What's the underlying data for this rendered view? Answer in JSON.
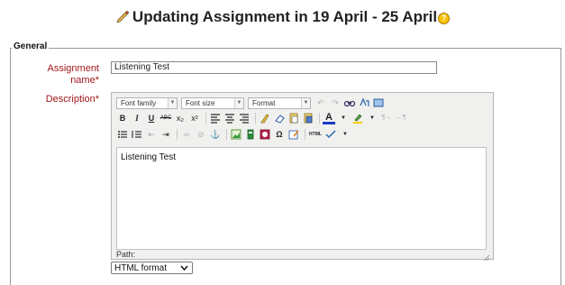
{
  "page": {
    "title": "Updating Assignment in 19 April - 25 April",
    "help_glyph": "?"
  },
  "form": {
    "legend": "General",
    "assignment_name": {
      "label": "Assignment name",
      "required_mark": "*",
      "value": "Listening Test"
    },
    "description": {
      "label": "Description",
      "required_mark": "*",
      "toolbar": {
        "font_family": "Font family",
        "font_size": "Font size",
        "format": "Format",
        "row2": [
          "B",
          "I",
          "U",
          "ABC",
          "x₂",
          "x²"
        ],
        "html_label": "HTML"
      },
      "content": "Listening Test",
      "path_label": "Path:"
    },
    "format_select": {
      "value": "HTML format"
    }
  },
  "colors": {
    "label_red": "#a3171b",
    "help_yellow": "#f5c200"
  },
  "icons": [
    "edit-icon",
    "help-icon",
    "undo-icon",
    "redo-icon",
    "find-icon",
    "replace-icon",
    "fullscreen-icon",
    "align-left-icon",
    "align-center-icon",
    "align-right-icon",
    "clean-icon",
    "eraser-icon",
    "paste-text-icon",
    "paste-word-icon",
    "font-color-icon",
    "highlight-icon",
    "ltr-icon",
    "rtl-icon",
    "bullet-list-icon",
    "numbered-list-icon",
    "outdent-icon",
    "indent-icon",
    "link-icon",
    "unlink-icon",
    "anchor-icon",
    "image-icon",
    "media-icon",
    "emoticon-icon",
    "special-char-icon",
    "nolink-icon",
    "html-icon",
    "spellcheck-icon",
    "resize-handle-icon"
  ]
}
